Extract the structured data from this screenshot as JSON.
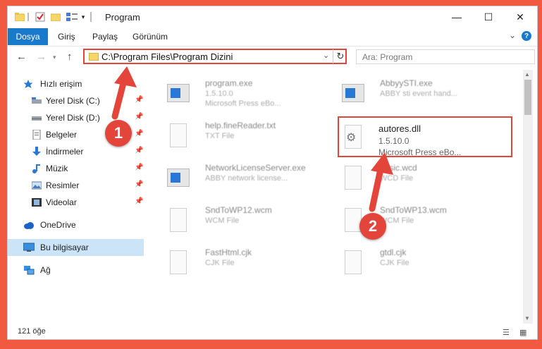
{
  "window": {
    "title": "Program",
    "controls": {
      "minimize": "—",
      "maximize": "☐",
      "close": "✕"
    }
  },
  "ribbon": {
    "tabs": [
      "Dosya",
      "Giriş",
      "Paylaş",
      "Görünüm"
    ],
    "help": "?",
    "expand": "⌄"
  },
  "address": {
    "path": "C:\\Program Files\\Program Dizini",
    "search_placeholder": "Ara: Program"
  },
  "sidebar": {
    "items": [
      {
        "label": "Hızlı erişim",
        "icon": "star-icon",
        "pinned": false
      },
      {
        "label": "Yerel Disk (C:)",
        "icon": "drive-icon",
        "pinned": true
      },
      {
        "label": "Yerel Disk (D:)",
        "icon": "drive-icon",
        "pinned": true
      },
      {
        "label": "Belgeler",
        "icon": "documents-icon",
        "pinned": true
      },
      {
        "label": "İndirmeler",
        "icon": "download-icon",
        "pinned": true
      },
      {
        "label": "Müzik",
        "icon": "music-icon",
        "pinned": true
      },
      {
        "label": "Resimler",
        "icon": "pictures-icon",
        "pinned": true
      },
      {
        "label": "Videolar",
        "icon": "video-icon",
        "pinned": true
      },
      {
        "label": "OneDrive",
        "icon": "cloud-icon",
        "pinned": false
      },
      {
        "label": "Bu bilgisayar",
        "icon": "computer-icon",
        "pinned": false,
        "selected": true
      },
      {
        "label": "Ağ",
        "icon": "network-icon",
        "pinned": false
      }
    ]
  },
  "files": [
    {
      "name": "program.exe",
      "line2": "1.5.10.0",
      "line3": "Microsoft Press eBo...",
      "icon": "exe-icon"
    },
    {
      "name": "AbbyySTI.exe",
      "line2": "ABBY sti event hand...",
      "line3": "",
      "icon": "exe-icon"
    },
    {
      "name": "help.fineReader.txt",
      "line2": "TXT File",
      "line3": "",
      "icon": "document-icon"
    },
    {
      "name": "autores.dll",
      "line2": "1.5.10.0",
      "line3": "Microsoft Press eBo...",
      "icon": "dll-icon",
      "highlighted": true
    },
    {
      "name": "NetworkLicenseServer.exe",
      "line2": "ABBY network license...",
      "line3": "",
      "icon": "exe-icon"
    },
    {
      "name": "basic.wcd",
      "line2": "WCD File",
      "line3": "",
      "icon": "document-icon"
    },
    {
      "name": "SndToWP12.wcm",
      "line2": "WCM File",
      "line3": "",
      "icon": "document-icon"
    },
    {
      "name": "SndToWP13.wcm",
      "line2": "WCM File",
      "line3": "",
      "icon": "document-icon"
    },
    {
      "name": "FastHtml.cjk",
      "line2": "CJK File",
      "line3": "",
      "icon": "document-icon"
    },
    {
      "name": "gtdl.cjk",
      "line2": "CJK File",
      "line3": "",
      "icon": "document-icon"
    }
  ],
  "status": {
    "count": "121 öğe"
  },
  "annotations": {
    "step1": "1",
    "step2": "2"
  },
  "colors": {
    "accent": "#1979ca",
    "highlight": "#e4453a",
    "background": "#f15a40"
  }
}
